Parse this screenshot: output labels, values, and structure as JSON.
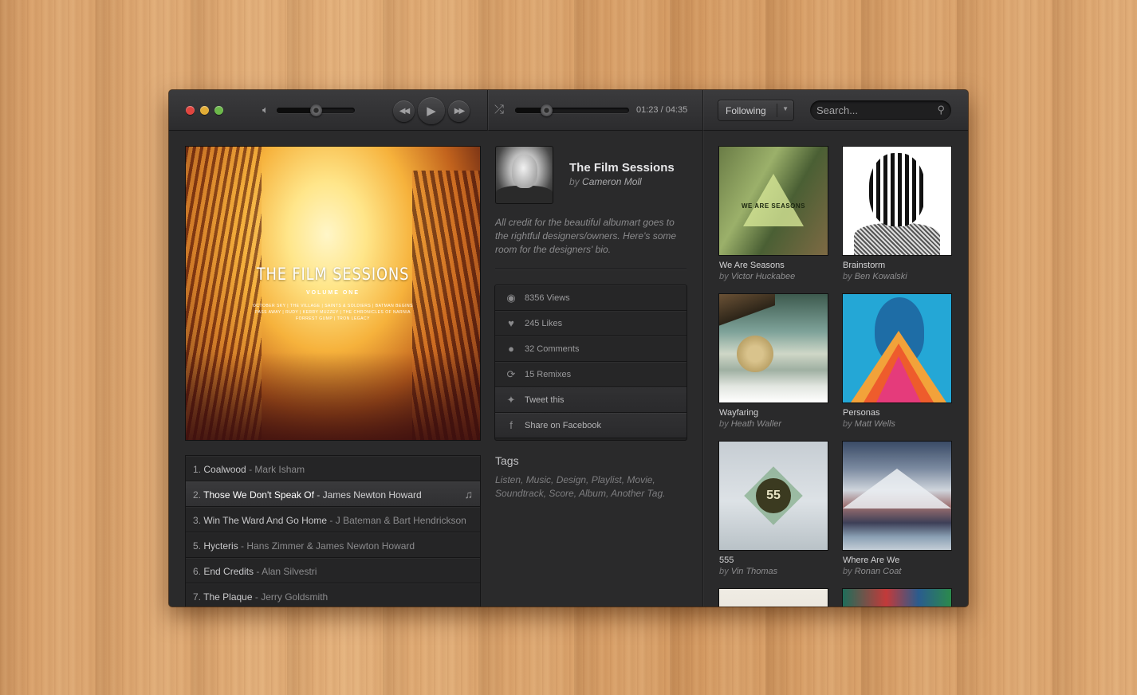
{
  "window": {
    "traffic_lights": [
      "close",
      "minimize",
      "zoom"
    ]
  },
  "player": {
    "volume_level": 0.5,
    "progress_level": 0.27,
    "time": "01:23 / 04:35",
    "controls": [
      "rewind-icon",
      "play-icon",
      "fast-forward-icon"
    ]
  },
  "toolbar": {
    "filter_value": "Following",
    "search_placeholder": "Search..."
  },
  "album": {
    "cover": {
      "title": "THE FILM SESSIONS",
      "subtitle": "VOLUME ONE",
      "lines": [
        "OCTOBER SKY  |  THE VILLAGE  |  SAINTS & SOLDIERS  |  BATMAN BEGINS",
        "PASS AWAY  |  RUDY  |  KERRY MUZZEY  |  THE CHRONICLES OF NARNIA",
        "FORREST GUMP  |  TRON LEGACY"
      ]
    },
    "title": "The Film Sessions",
    "by_prefix": "by",
    "artist": "Cameron Moll",
    "bio": "All credit for the beautiful albumart goes to the rightful designers/owners. Here's some room for the designers' bio."
  },
  "tracks": [
    {
      "num": "1.",
      "title": "Coalwood",
      "artist": "Mark Isham",
      "active": false
    },
    {
      "num": "2.",
      "title": "Those We Don't Speak Of",
      "artist": "James Newton Howard",
      "active": true
    },
    {
      "num": "3.",
      "title": "Win The Ward And Go Home",
      "artist": "J Bateman & Bart Hendrickson",
      "active": false
    },
    {
      "num": "5.",
      "title": "Hycteris",
      "artist": "Hans Zimmer & James Newton Howard",
      "active": false
    },
    {
      "num": "6.",
      "title": "End Credits",
      "artist": "Alan Silvestri",
      "active": false
    },
    {
      "num": "7.",
      "title": "The Plaque",
      "artist": "Jerry Goldsmith",
      "active": false
    }
  ],
  "track_separator": " - ",
  "stats": [
    {
      "icon": "eye-icon",
      "label": "8356 Views"
    },
    {
      "icon": "heart-icon",
      "label": "245 Likes"
    },
    {
      "icon": "comment-icon",
      "label": "32 Comments"
    },
    {
      "icon": "remix-icon",
      "label": "15 Remixes"
    },
    {
      "icon": "twitter-icon",
      "label": "Tweet this"
    },
    {
      "icon": "facebook-icon",
      "label": "Share on Facebook"
    }
  ],
  "tags": {
    "heading": "Tags",
    "list": "Listen, Music, Design, Playlist, Movie, Soundtrack, Score, Album, Another Tag."
  },
  "related": [
    {
      "title": "We Are Seasons",
      "by": "by",
      "artist": "Victor Huckabee",
      "art_text": "WE ARE SEASONS"
    },
    {
      "title": "Brainstorm",
      "by": "by",
      "artist": "Ben Kowalski",
      "art_text": ""
    },
    {
      "title": "Wayfaring",
      "by": "by",
      "artist": "Heath Waller",
      "art_text": ""
    },
    {
      "title": "Personas",
      "by": "by",
      "artist": "Matt Wells",
      "art_text": ""
    },
    {
      "title": "555",
      "by": "by",
      "artist": "Vin Thomas",
      "art_text": "55"
    },
    {
      "title": "Where Are We",
      "by": "by",
      "artist": "Ronan Coat",
      "art_text": ""
    }
  ]
}
